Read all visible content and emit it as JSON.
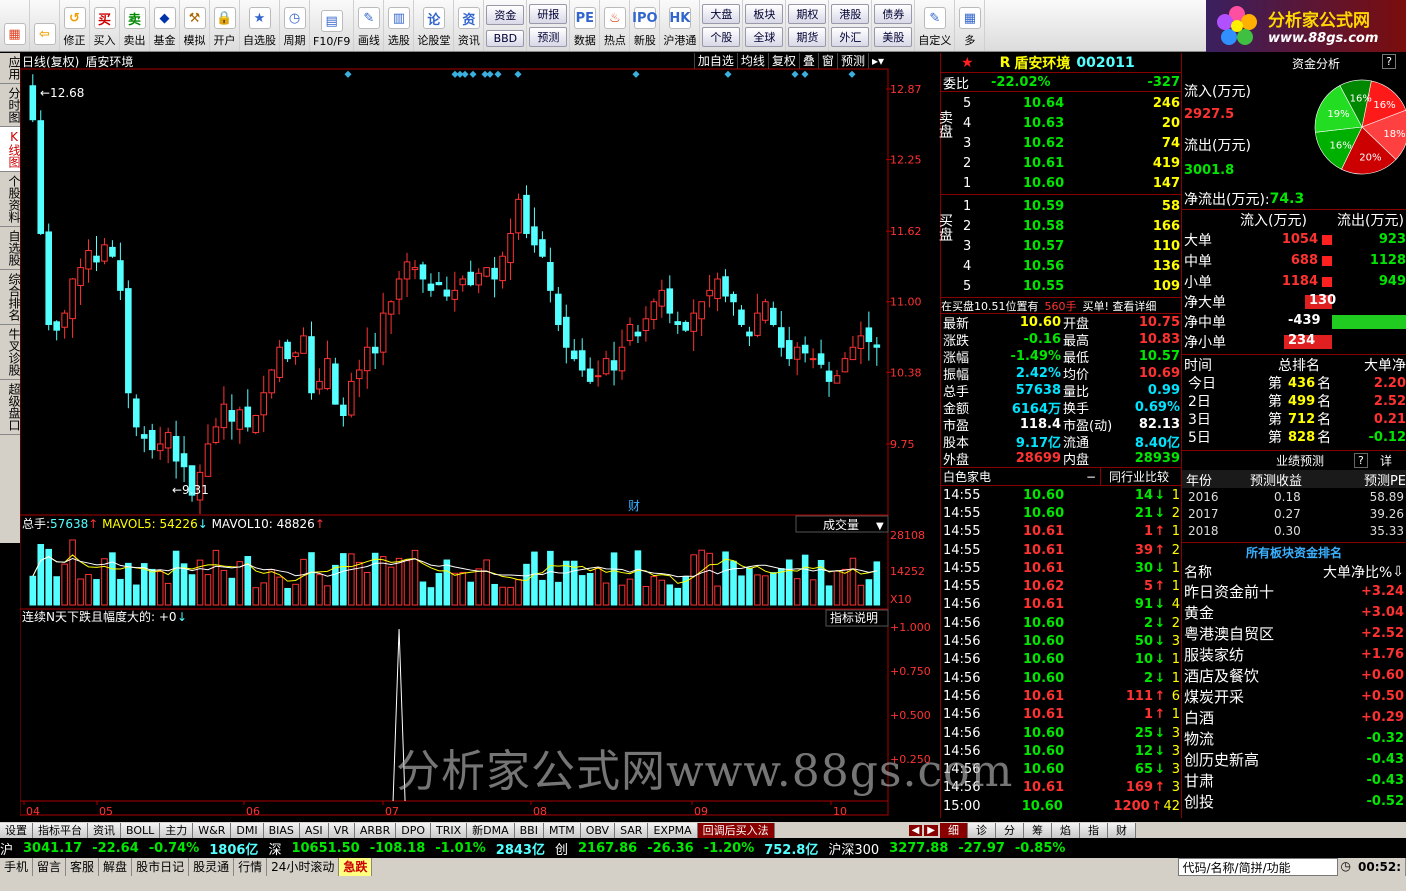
{
  "toolbar": {
    "buttons": [
      {
        "label": "",
        "icon": "windows-grid-icon",
        "color": "#e04020"
      },
      {
        "label": "",
        "icon": "back-arrow-icon",
        "color": "#f0a000"
      },
      {
        "label": "修正",
        "icon": "undo-icon",
        "color": "#f0a000"
      },
      {
        "label": "买入",
        "icon": "buy-icon",
        "color": "#c00"
      },
      {
        "label": "卖出",
        "icon": "sell-icon",
        "color": "#080"
      },
      {
        "label": "基金",
        "icon": "fund-icon",
        "color": "#03a"
      },
      {
        "label": "模拟",
        "icon": "hammer-icon",
        "color": "#a60"
      },
      {
        "label": "开户",
        "icon": "lock-icon",
        "color": "#a80"
      },
      {
        "label": "自选股",
        "icon": "star-icon",
        "color": "#36c"
      },
      {
        "label": "周期",
        "icon": "clock-icon",
        "color": "#36c"
      },
      {
        "label": "F10/F9",
        "icon": "f10-icon",
        "color": "#36c"
      },
      {
        "label": "画线",
        "icon": "pencil-icon",
        "color": "#36c"
      },
      {
        "label": "选股",
        "icon": "filter-icon",
        "color": "#36c"
      },
      {
        "label": "论股堂",
        "icon": "discuss-icon",
        "color": "#36c"
      },
      {
        "label": "资讯",
        "icon": "news-icon",
        "color": "#36c"
      }
    ],
    "pairs": [
      {
        "top": "资金",
        "bottom": "BBD"
      },
      {
        "top": "研报",
        "bottom": "预测"
      }
    ],
    "buttons2": [
      {
        "label": "数据",
        "icon": "pe-icon",
        "color": "#36c"
      },
      {
        "label": "热点",
        "icon": "hot-icon",
        "color": "#c30"
      },
      {
        "label": "新股",
        "icon": "ipo-icon",
        "color": "#36c"
      },
      {
        "label": "沪港通",
        "icon": "shhk-icon",
        "color": "#36c"
      }
    ],
    "pairs2": [
      {
        "top": "大盘",
        "bottom": "个股"
      },
      {
        "top": "板块",
        "bottom": "全球"
      },
      {
        "top": "期权",
        "bottom": "期货"
      },
      {
        "top": "港股",
        "bottom": "外汇"
      },
      {
        "top": "债券",
        "bottom": "美股"
      }
    ],
    "buttons3": [
      {
        "label": "自定义",
        "icon": "custom-icon",
        "color": "#36c"
      },
      {
        "label": "多",
        "icon": "multi-icon",
        "color": "#36c"
      }
    ]
  },
  "brand": {
    "name": "分析家公式网",
    "url": "www.88gs.com"
  },
  "left_tabs": [
    {
      "label": "应用"
    },
    {
      "label": "分时图"
    },
    {
      "label": "K线图",
      "active": true
    },
    {
      "label": "个股资料"
    },
    {
      "label": "自选股"
    },
    {
      "label": "综合排名"
    },
    {
      "label": "牛叉诊股"
    },
    {
      "label": "超级盘口"
    }
  ],
  "chart": {
    "header": {
      "period": "日线(复权)",
      "name": "盾安环境"
    },
    "buttons": [
      "加自选",
      "均线",
      "复权",
      "叠",
      "窗",
      "预测"
    ],
    "price_axis": [
      "12.87",
      "12.25",
      "11.62",
      "11.00",
      "10.38",
      "9.75"
    ],
    "high_label": "12.68",
    "low_label": "9.31",
    "finance_marker": "财",
    "vol_header": {
      "total_label": "总手:",
      "total": "57638",
      "mavol5_label": "MAVOL5:",
      "mavol5": "54226",
      "mavol10_label": "MAVOL10:",
      "mavol10": "48826"
    },
    "vol_button": "成交量",
    "vol_axis": [
      "28108",
      "14252",
      "X10"
    ],
    "ind_header": "连续N天下跌且幅度大的: +0",
    "ind_button": "指标说明",
    "ind_axis": [
      "+1.000",
      "+0.750",
      "+0.500",
      "+0.250"
    ],
    "months": [
      "04",
      "05",
      "06",
      "07",
      "08",
      "09",
      "10"
    ]
  },
  "chart_data": {
    "type": "candlestick",
    "ylim": [
      9.31,
      12.87
    ],
    "high": 12.68,
    "low": 9.31,
    "close_series": [
      12.6,
      11.6,
      10.8,
      10.75,
      10.9,
      11.2,
      11.3,
      11.45,
      11.35,
      11.5,
      11.4,
      11.1,
      10.2,
      9.9,
      9.8,
      9.7,
      9.75,
      9.85,
      9.6,
      9.55,
      9.3,
      9.5,
      9.75,
      9.9,
      10.1,
      9.95,
      10.05,
      9.9,
      10.0,
      10.2,
      10.4,
      10.6,
      10.5,
      10.55,
      10.7,
      10.2,
      10.3,
      10.5,
      10.1,
      10.0,
      10.3,
      10.4,
      10.6,
      10.55,
      10.9,
      11.0,
      11.2,
      11.35,
      11.3,
      11.2,
      11.1,
      11.15,
      11.05,
      11.1,
      11.2,
      11.15,
      11.25,
      11.3,
      11.2,
      11.4,
      11.6,
      11.9,
      11.6,
      11.5,
      11.4,
      11.1,
      10.8,
      10.6,
      10.5,
      10.4,
      10.3,
      10.35,
      10.5,
      10.4,
      10.6,
      10.8,
      10.7,
      10.85,
      11.0,
      11.1,
      10.9,
      10.8,
      10.75,
      10.9,
      11.0,
      11.1,
      11.2,
      11.05,
      11.0,
      10.8,
      10.7,
      10.9,
      11.0,
      10.8,
      10.6,
      10.5,
      10.6,
      10.55,
      10.5,
      10.45,
      10.3,
      10.35,
      10.5,
      10.6,
      10.7,
      10.65,
      10.6
    ],
    "vol_total": 57638,
    "mavol5": 54226,
    "mavol10": 48826,
    "signal_peak_index": 46
  },
  "quote": {
    "name": "盾安环境",
    "code": "002011",
    "flag": "R",
    "weibi": {
      "label": "委比",
      "pct": "-22.02%",
      "diff": "-327"
    },
    "sell_label": "卖盘",
    "buy_label": "买盘",
    "sells": [
      {
        "lvl": "5",
        "price": "10.64",
        "vol": "246"
      },
      {
        "lvl": "4",
        "price": "10.63",
        "vol": "20"
      },
      {
        "lvl": "3",
        "price": "10.62",
        "vol": "74"
      },
      {
        "lvl": "2",
        "price": "10.61",
        "vol": "419"
      },
      {
        "lvl": "1",
        "price": "10.60",
        "vol": "147"
      }
    ],
    "buys": [
      {
        "lvl": "1",
        "price": "10.59",
        "vol": "58"
      },
      {
        "lvl": "2",
        "price": "10.58",
        "vol": "166"
      },
      {
        "lvl": "3",
        "price": "10.57",
        "vol": "110"
      },
      {
        "lvl": "4",
        "price": "10.56",
        "vol": "136"
      },
      {
        "lvl": "5",
        "price": "10.55",
        "vol": "109"
      }
    ],
    "position": {
      "text": "在买盘10.51位置有",
      "qty": "560手",
      "tip": "买单! 查看详细"
    },
    "stats": [
      {
        "l1": "最新",
        "v1": "10.60",
        "c1": "yellow",
        "l2": "开盘",
        "v2": "10.75",
        "c2": "red"
      },
      {
        "l1": "涨跌",
        "v1": "-0.16",
        "c1": "green",
        "l2": "最高",
        "v2": "10.83",
        "c2": "red"
      },
      {
        "l1": "涨幅",
        "v1": "-1.49%",
        "c1": "green",
        "l2": "最低",
        "v2": "10.57",
        "c2": "green"
      },
      {
        "l1": "振幅",
        "v1": "2.42%",
        "c1": "cyan",
        "l2": "均价",
        "v2": "10.69",
        "c2": "red"
      },
      {
        "l1": "总手",
        "v1": "57638",
        "c1": "cyan",
        "l2": "量比",
        "v2": "0.99",
        "c2": "cyan"
      },
      {
        "l1": "金额",
        "v1": "6164万",
        "c1": "cyan",
        "l2": "换手",
        "v2": "0.69%",
        "c2": "cyan"
      },
      {
        "l1": "市盈",
        "v1": "118.4",
        "c1": "white",
        "l2": "市盈(动)",
        "v2": "82.13",
        "c2": "white"
      },
      {
        "l1": "股本",
        "v1": "9.17亿",
        "c1": "cyan",
        "l2": "流通",
        "v2": "8.40亿",
        "c2": "cyan"
      },
      {
        "l1": "外盘",
        "v1": "28699",
        "c1": "red",
        "l2": "内盘",
        "v2": "28939",
        "c2": "green"
      }
    ],
    "industry": {
      "label": "白色家电",
      "compare": "同行业比较"
    },
    "ticks": [
      {
        "t": "14:55",
        "p": "10.60",
        "v": "14",
        "d": "down",
        "n": "1"
      },
      {
        "t": "14:55",
        "p": "10.60",
        "v": "21",
        "d": "down",
        "n": "2"
      },
      {
        "t": "14:55",
        "p": "10.61",
        "v": "1",
        "d": "up",
        "n": "1"
      },
      {
        "t": "14:55",
        "p": "10.61",
        "v": "39",
        "d": "up",
        "n": "2"
      },
      {
        "t": "14:55",
        "p": "10.61",
        "v": "30",
        "d": "down",
        "n": "1"
      },
      {
        "t": "14:55",
        "p": "10.62",
        "v": "5",
        "d": "up",
        "n": "1"
      },
      {
        "t": "14:56",
        "p": "10.61",
        "v": "91",
        "d": "down",
        "n": "4"
      },
      {
        "t": "14:56",
        "p": "10.60",
        "v": "2",
        "d": "down",
        "n": "2"
      },
      {
        "t": "14:56",
        "p": "10.60",
        "v": "50",
        "d": "down",
        "n": "3"
      },
      {
        "t": "14:56",
        "p": "10.60",
        "v": "10",
        "d": "down",
        "n": "1"
      },
      {
        "t": "14:56",
        "p": "10.60",
        "v": "2",
        "d": "down",
        "n": "1"
      },
      {
        "t": "14:56",
        "p": "10.61",
        "v": "111",
        "d": "up",
        "n": "6"
      },
      {
        "t": "14:56",
        "p": "10.61",
        "v": "1",
        "d": "up",
        "n": "1"
      },
      {
        "t": "14:56",
        "p": "10.60",
        "v": "25",
        "d": "down",
        "n": "3"
      },
      {
        "t": "14:56",
        "p": "10.60",
        "v": "12",
        "d": "down",
        "n": "3"
      },
      {
        "t": "14:56",
        "p": "10.60",
        "v": "65",
        "d": "down",
        "n": "3"
      },
      {
        "t": "14:56",
        "p": "10.61",
        "v": "169",
        "d": "up",
        "n": "3"
      },
      {
        "t": "15:00",
        "p": "10.60",
        "v": "1200",
        "d": "up",
        "n": "42"
      }
    ],
    "tabs": [
      "细",
      "诊",
      "分",
      "筹",
      "焰",
      "指",
      "财"
    ]
  },
  "fund": {
    "title": "资金分析",
    "inflow_label": "流入(万元)",
    "inflow": "2927.5",
    "outflow_label": "流出(万元)",
    "outflow": "3001.8",
    "net_label": "净流出(万元):",
    "net": "74.3",
    "pie": [
      {
        "label": "16%",
        "value": 16,
        "color": "#ff2020"
      },
      {
        "label": "18%",
        "value": 18,
        "color": "#ff2020"
      },
      {
        "label": "20%",
        "value": 20,
        "color": "#cc0000"
      },
      {
        "label": "16%",
        "value": 16,
        "color": "#00aa00"
      },
      {
        "label": "19%",
        "value": 19,
        "color": "#00cc00"
      },
      {
        "label": "16%",
        "value": 11,
        "color": "#009900"
      }
    ],
    "flow_head": {
      "in": "流入(万元)",
      "out": "流出(万元)"
    },
    "flows": [
      {
        "label": "大单",
        "in": "1054",
        "out": "923"
      },
      {
        "label": "中单",
        "in": "688",
        "out": "1128"
      },
      {
        "label": "小单",
        "in": "1184",
        "out": "949"
      }
    ],
    "nets": [
      {
        "label": "净大单",
        "value": "130",
        "color": "red",
        "bar": 0.3
      },
      {
        "label": "净中单",
        "value": "-439",
        "color": "green",
        "bar": 1.0
      },
      {
        "label": "净小单",
        "value": "234",
        "color": "red",
        "bar": 0.53
      }
    ],
    "rank_head": {
      "c1": "时间",
      "c2": "总排名",
      "c3": "大单净"
    },
    "ranks": [
      {
        "t": "今日",
        "r": "436",
        "v": "2.20"
      },
      {
        "t": "2日",
        "r": "499",
        "v": "2.52"
      },
      {
        "t": "3日",
        "r": "712",
        "v": "0.21"
      },
      {
        "t": "5日",
        "r": "828",
        "v": "-0.12"
      }
    ],
    "rank_prefix": "第",
    "rank_suffix": "名",
    "forecast_title": "业绩预测",
    "forecast_head": {
      "c1": "年份",
      "c2": "预测收益",
      "c3": "预测PE"
    },
    "forecast": [
      {
        "y": "2016",
        "e": "0.18",
        "pe": "58.89"
      },
      {
        "y": "2017",
        "e": "0.27",
        "pe": "39.26"
      },
      {
        "y": "2018",
        "e": "0.30",
        "pe": "35.33"
      }
    ],
    "sector_title": "所有板块资金排名",
    "sector_head": {
      "c1": "名称",
      "c2": "大单净比%"
    },
    "sectors": [
      {
        "n": "昨日资金前十",
        "v": "+3.24"
      },
      {
        "n": "黄金",
        "v": "+3.04"
      },
      {
        "n": "粤港澳自贸区",
        "v": "+2.52"
      },
      {
        "n": "服装家纺",
        "v": "+1.76"
      },
      {
        "n": "酒店及餐饮",
        "v": "+0.60"
      },
      {
        "n": "煤炭开采",
        "v": "+0.50"
      },
      {
        "n": "白酒",
        "v": "+0.29"
      },
      {
        "n": "物流",
        "v": "-0.32"
      },
      {
        "n": "创历史新高",
        "v": "-0.43"
      },
      {
        "n": "甘肃",
        "v": "-0.43"
      },
      {
        "n": "创投",
        "v": "-0.52"
      }
    ]
  },
  "index_tabs": [
    "设置",
    "指标平台",
    "资讯",
    "BOLL",
    "主力",
    "W&R",
    "DMI",
    "BIAS",
    "ASI",
    "VR",
    "ARBR",
    "DPO",
    "TRIX",
    "新DMA",
    "BBI",
    "MTM",
    "OBV",
    "SAR",
    "EXPMA",
    "回调后买入法"
  ],
  "ticker": [
    {
      "t": "沪",
      "c": "white"
    },
    {
      "t": "3041.17",
      "c": "green"
    },
    {
      "t": "-22.64",
      "c": "green"
    },
    {
      "t": "-0.74%",
      "c": "green"
    },
    {
      "t": "1806亿",
      "c": "cyan"
    },
    {
      "t": "深",
      "c": "white"
    },
    {
      "t": "10651.50",
      "c": "green"
    },
    {
      "t": "-108.18",
      "c": "green"
    },
    {
      "t": "-1.01%",
      "c": "green"
    },
    {
      "t": "2843亿",
      "c": "cyan"
    },
    {
      "t": "创",
      "c": "white"
    },
    {
      "t": "2167.86",
      "c": "green"
    },
    {
      "t": "-26.36",
      "c": "green"
    },
    {
      "t": "-1.20%",
      "c": "green"
    },
    {
      "t": "752.8亿",
      "c": "cyan"
    },
    {
      "t": "沪深300",
      "c": "white"
    },
    {
      "t": "3277.88",
      "c": "green"
    },
    {
      "t": "-27.97",
      "c": "green"
    },
    {
      "t": "-0.85%",
      "c": "green"
    }
  ],
  "statusbar": {
    "items": [
      "手机",
      "留言",
      "客服",
      "解盘",
      "股市日记",
      "股灵通",
      "行情",
      "24小时滚动"
    ],
    "alert": "急跌",
    "search": "代码/名称/简拼/功能",
    "time": "00:52:"
  },
  "watermark": "分析家公式网www.88gs.com"
}
